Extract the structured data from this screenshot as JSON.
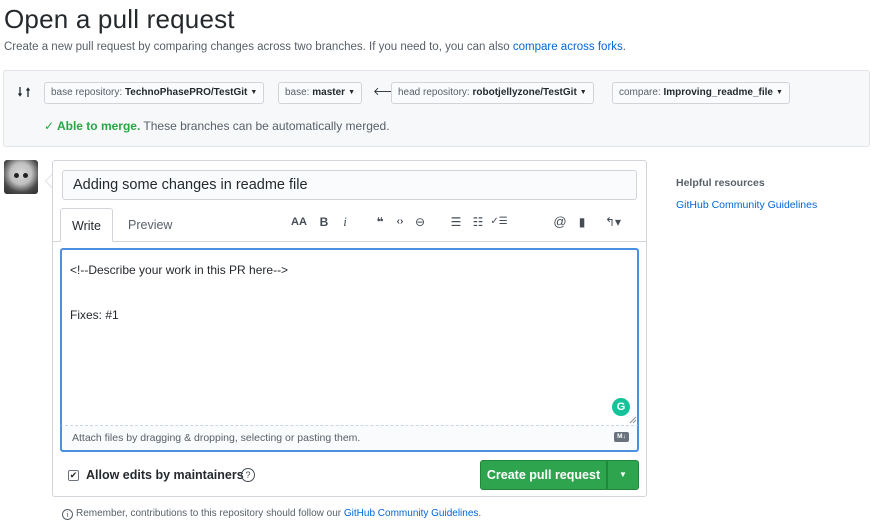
{
  "page": {
    "title": "Open a pull request",
    "subtitle": "Create a new pull request by comparing changes across two branches. If you need to, you can also ",
    "subtitle_link": "compare across forks",
    "subtitle_end": "."
  },
  "range": {
    "base_repo_prefix": "base repository: ",
    "base_repo_value": "TechnoPhasePRO/TestGit",
    "base_prefix": "base: ",
    "base_value": "master",
    "head_repo_prefix": "head repository: ",
    "head_repo_value": "robotjellyzone/TestGit",
    "compare_prefix": "compare: ",
    "compare_value": "Improving_readme_file",
    "merge_check": "✓ Able to merge.",
    "merge_text": " These branches can be automatically merged."
  },
  "form": {
    "title_value": "Adding some changes in readme file",
    "tabs": {
      "write": "Write",
      "preview": "Preview"
    },
    "toolbar": {
      "header": "AA",
      "bold": "B",
      "italic": "i",
      "quote": "❝",
      "code": "‹›",
      "link": "⊖",
      "unordered_list": "☰",
      "ordered_list": "☷",
      "task_list": "✓☰",
      "mention": "@",
      "reference": "▮",
      "reply": "↰▾"
    },
    "body_lines": [
      "<!--Describe your work in this PR here-->",
      "",
      "Fixes: #1"
    ],
    "grammarly": "G",
    "attach_text": "Attach files by dragging & dropping, selecting or pasting them.",
    "markdown_badge": "M↓",
    "allow_edits_label": "Allow edits by maintainers",
    "help_symbol": "?",
    "create_button": "Create pull request",
    "create_caret": "▼"
  },
  "footer": {
    "info_symbol": "i",
    "remember_text": "Remember, contributions to this repository should follow our ",
    "remember_link": "GitHub Community Guidelines",
    "remember_end": "."
  },
  "sidebar": {
    "heading": "Helpful resources",
    "link": "GitHub Community Guidelines"
  },
  "colors": {
    "accent": "#0366d6",
    "success": "#28a745",
    "button": "#2ea44f",
    "focus": "#4a90e2"
  },
  "icons": [
    "compare-icon",
    "caret-down-icon",
    "arrow-left-icon",
    "check-icon",
    "grammarly-icon",
    "markdown-icon",
    "question-icon",
    "info-icon"
  ]
}
